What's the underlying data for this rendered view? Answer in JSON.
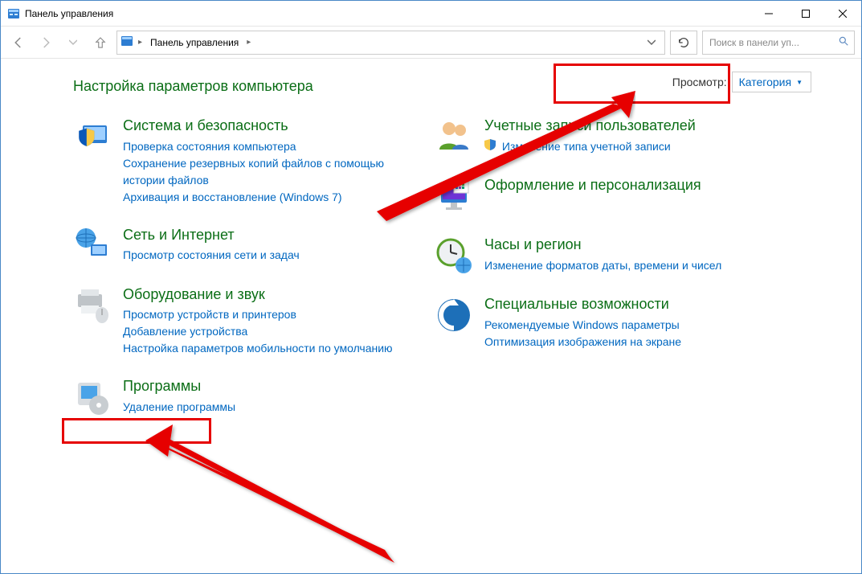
{
  "window": {
    "title": "Панель управления"
  },
  "address": {
    "root": "Панель управления"
  },
  "search": {
    "placeholder": "Поиск в панели уп..."
  },
  "heading": "Настройка параметров компьютера",
  "view": {
    "label": "Просмотр:",
    "value": "Категория"
  },
  "left": [
    {
      "title": "Система и безопасность",
      "links": [
        "Проверка состояния компьютера",
        "Сохранение резервных копий файлов с помощью истории файлов",
        "Архивация и восстановление (Windows 7)"
      ]
    },
    {
      "title": "Сеть и Интернет",
      "links": [
        "Просмотр состояния сети и задач"
      ]
    },
    {
      "title": "Оборудование и звук",
      "links": [
        "Просмотр устройств и принтеров",
        "Добавление устройства",
        "Настройка параметров мобильности по умолчанию"
      ]
    },
    {
      "title": "Программы",
      "links": [
        "Удаление программы"
      ]
    }
  ],
  "right": [
    {
      "title": "Учетные записи пользователей",
      "links": [
        "Изменение типа учетной записи"
      ],
      "shield": [
        true
      ]
    },
    {
      "title": "Оформление и персонализация",
      "links": []
    },
    {
      "title": "Часы и регион",
      "links": [
        "Изменение форматов даты, времени и чисел"
      ]
    },
    {
      "title": "Специальные возможности",
      "links": [
        "Рекомендуемые Windows параметры",
        "Оптимизация изображения на экране"
      ]
    }
  ]
}
